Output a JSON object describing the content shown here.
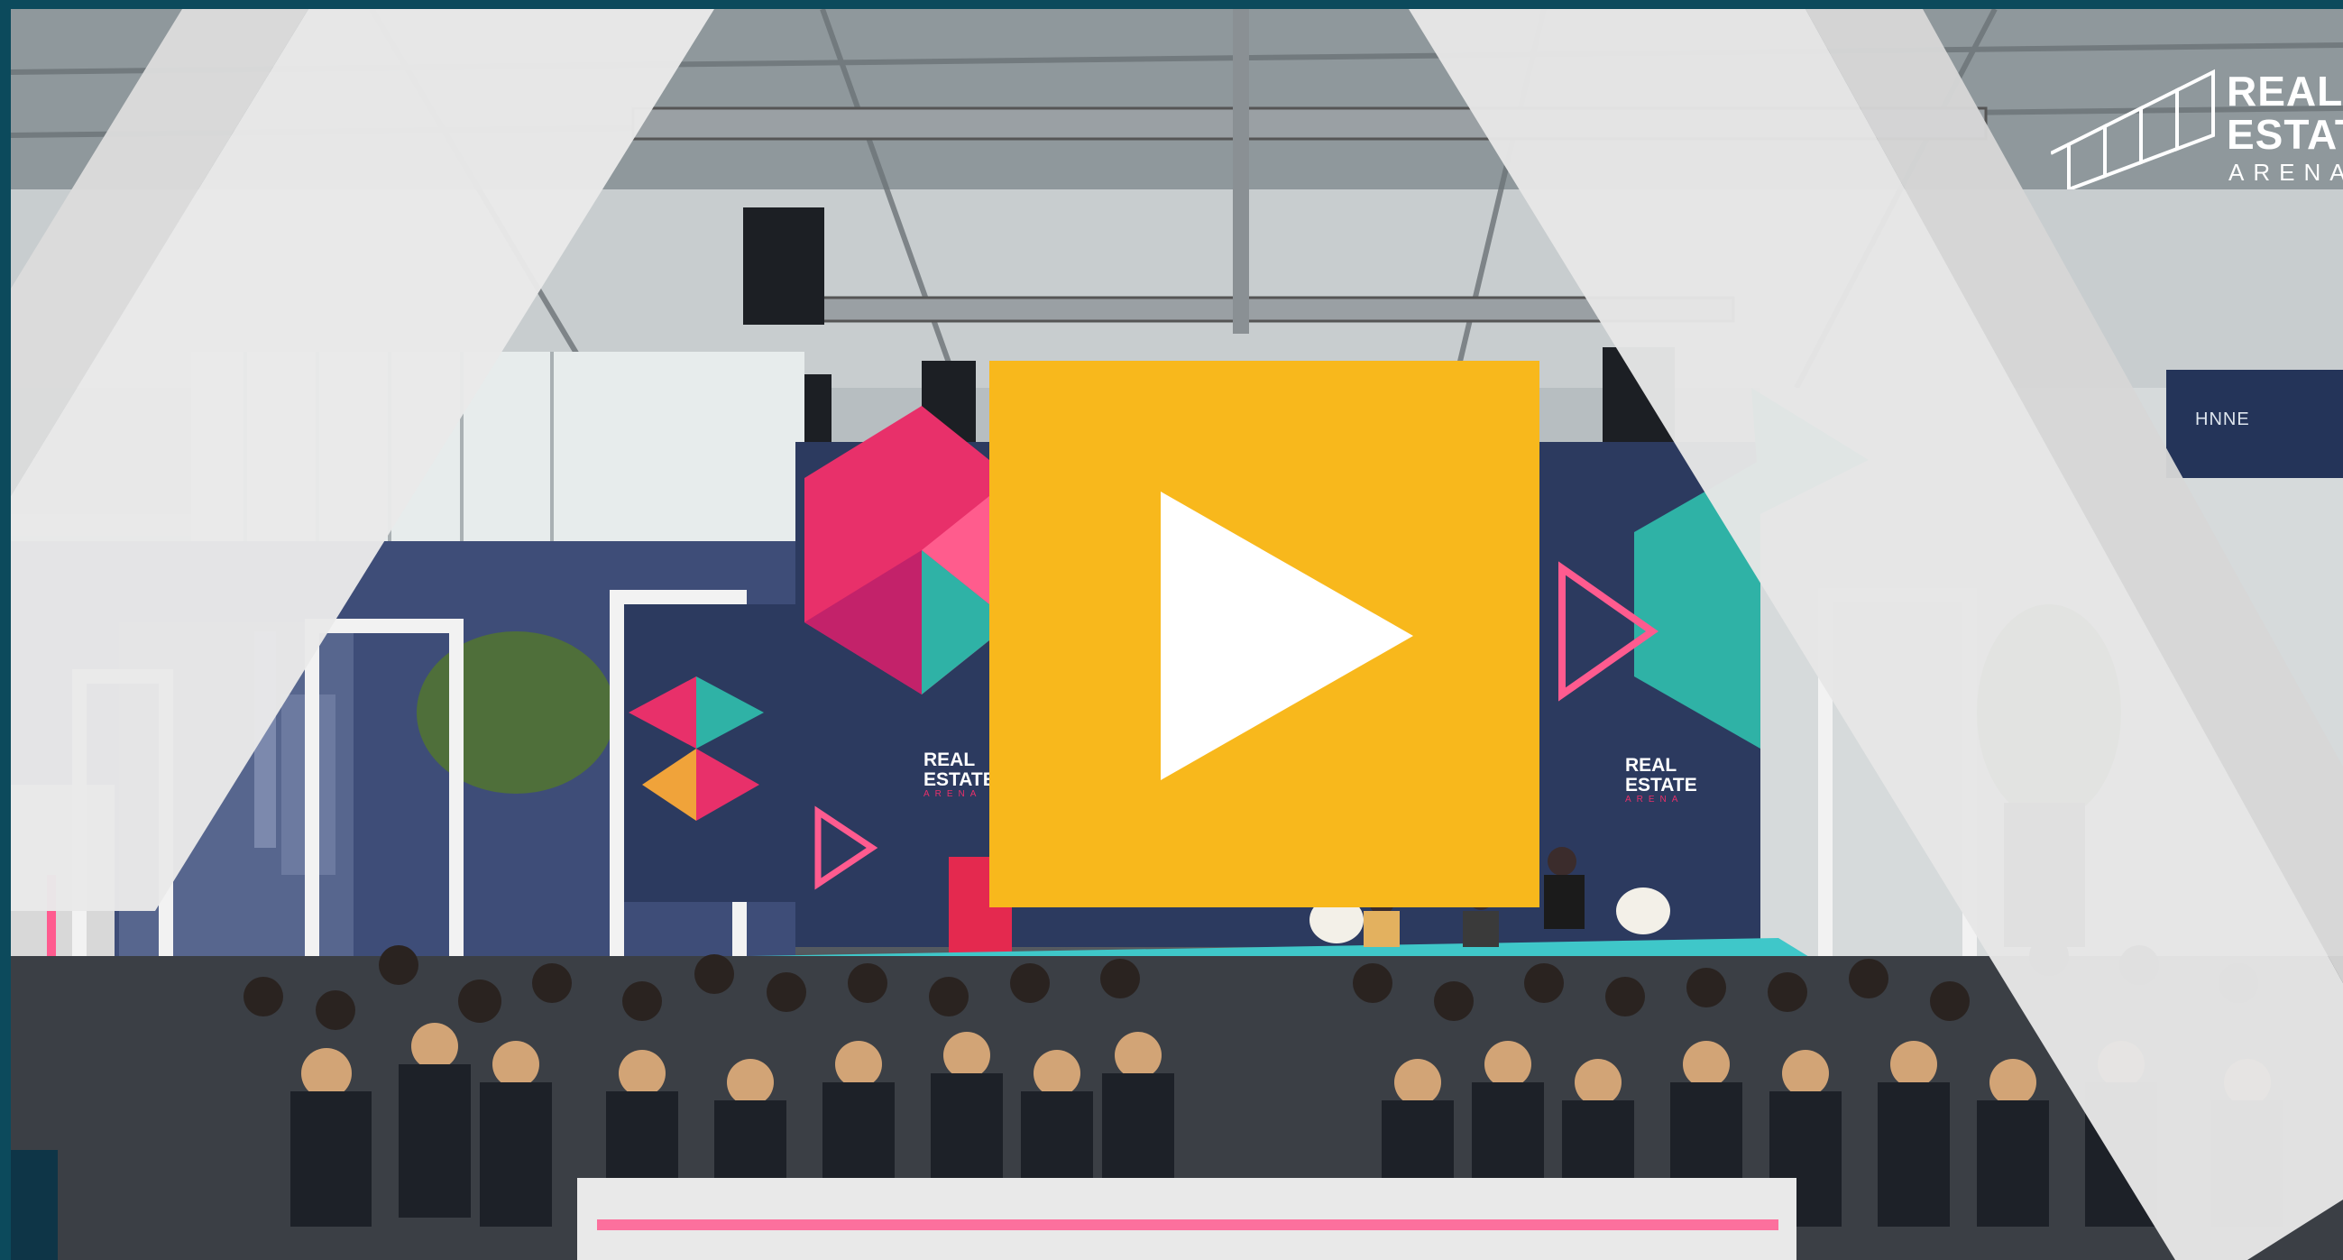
{
  "video": {
    "logo": {
      "line1": "REAL",
      "line2": "ESTAT",
      "line3": "ARENA"
    },
    "stage_sign_left": {
      "line1": "REAL",
      "line2": "ESTATE",
      "line3": "ARENA"
    },
    "stage_sign_right": {
      "line1": "REAL",
      "line2": "ESTATE",
      "line3": "ARENA"
    },
    "hall_sign": "HNNE",
    "play_icon": "play-icon",
    "colors": {
      "frame": "#0c4a5c",
      "play_button": "#f8b81c",
      "play_triangle": "#ffffff",
      "stage_floor": "#3fc7c9",
      "accent_pink": "#e8306a",
      "accent_teal": "#2fb2a6",
      "navy_wall": "#2c3a5f"
    }
  }
}
